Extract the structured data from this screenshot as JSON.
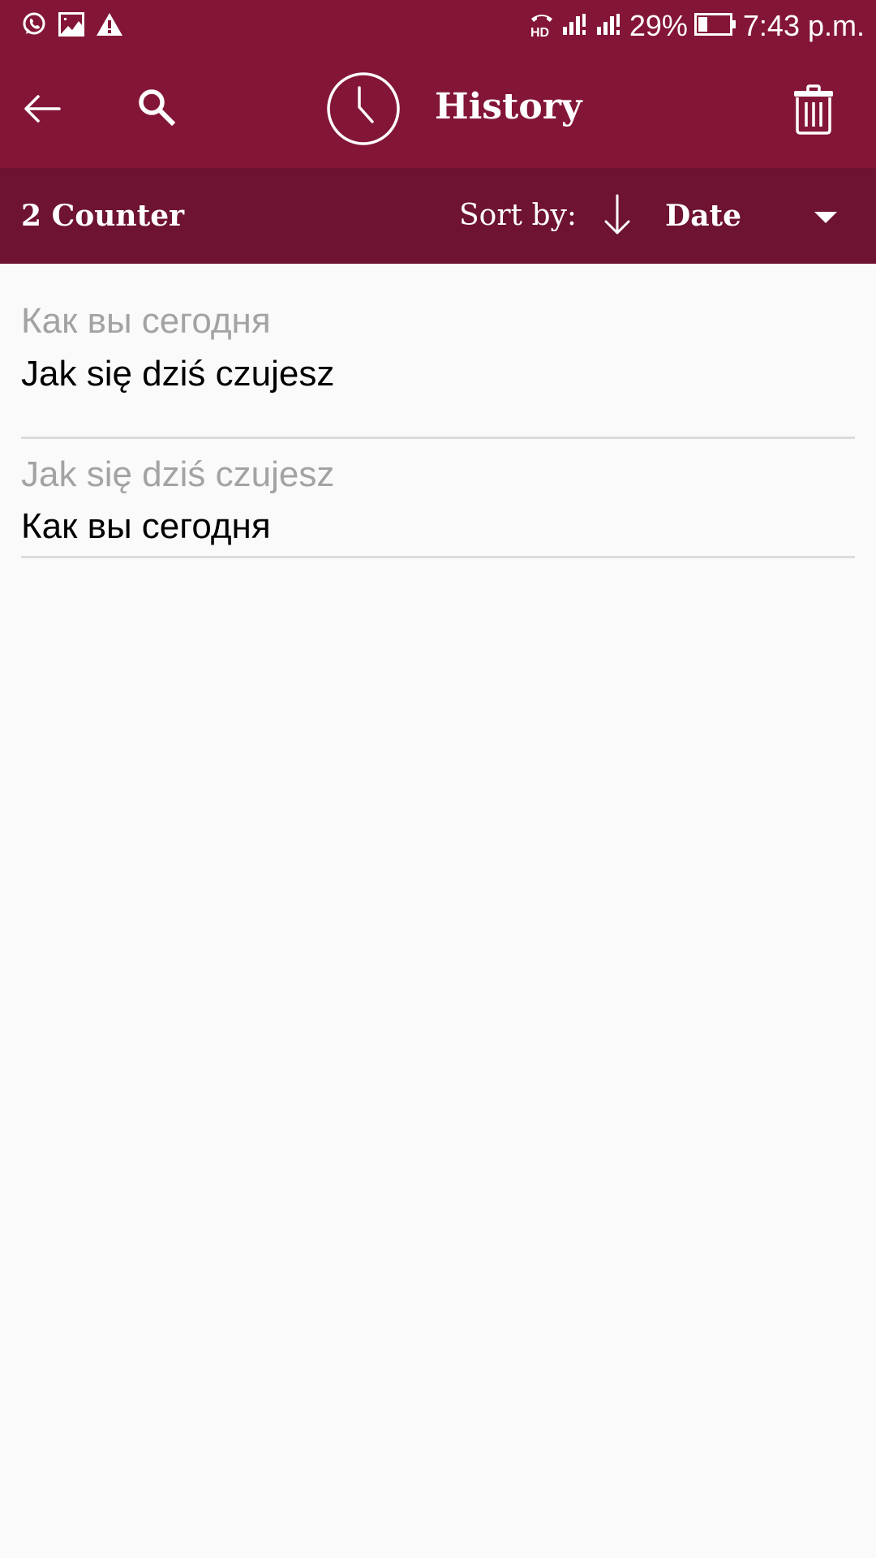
{
  "status_bar": {
    "left_icons": [
      "whatsapp-icon",
      "gallery-icon",
      "warning-icon"
    ],
    "right_icons": [
      "hd-call-icon",
      "signal-sim1-icon",
      "signal-sim2-icon",
      "battery-icon"
    ],
    "battery_percent": "29%",
    "battery_level": 0.29,
    "time": "7:43 p.m."
  },
  "app_bar": {
    "back_icon": "arrow-left-icon",
    "search_icon": "search-icon",
    "title_icon": "clock-icon",
    "title": "History",
    "delete_icon": "trash-icon"
  },
  "sub_bar": {
    "counter": "2 Counter",
    "sort_label": "Sort by:",
    "sort_direction_icon": "arrow-down-icon",
    "sort_value": "Date",
    "dropdown_icon": "caret-down-icon"
  },
  "history": [
    {
      "source": "Как вы сегодня",
      "translation": "Jak się dziś czujesz"
    },
    {
      "source": "Jak się dziś czujesz",
      "translation": "Как вы сегодня"
    }
  ],
  "colors": {
    "primary": "#831637",
    "primary_dark": "#6e1331",
    "background": "#fafafa",
    "source_text": "#a3a3a3",
    "translation_text": "#000000",
    "divider": "#dcdcdc"
  }
}
